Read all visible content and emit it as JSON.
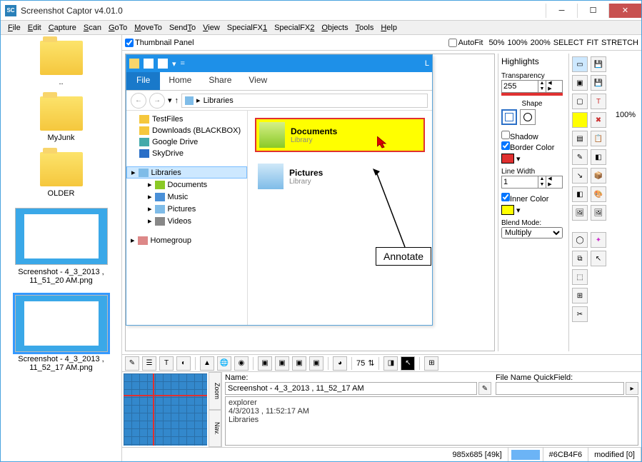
{
  "window": {
    "title": "Screenshot Captor v4.01.0"
  },
  "menus": [
    "File",
    "Edit",
    "Capture",
    "Scan",
    "GoTo",
    "MoveTo",
    "SendTo",
    "View",
    "SpecialFX1",
    "SpecialFX2",
    "Objects",
    "Tools",
    "Help"
  ],
  "left_thumbs": [
    {
      "label": ".."
    },
    {
      "label": "MyJunk"
    },
    {
      "label": "OLDER"
    },
    {
      "label": "Screenshot - 4_3_2013 , 11_51_20 AM.png",
      "type": "ss"
    },
    {
      "label": "Screenshot - 4_3_2013 , 11_52_17 AM.png",
      "type": "ss",
      "selected": true
    }
  ],
  "top_toolbar": {
    "thumbnail_panel": "Thumbnail Panel",
    "autofit": "AutoFit",
    "zoom": [
      "50%",
      "100%",
      "200%",
      "SELECT",
      "FIT",
      "STRETCH"
    ]
  },
  "explorer": {
    "ribbon": {
      "file": "File",
      "tabs": [
        "Home",
        "Share",
        "View"
      ]
    },
    "breadcrumb": "Libraries",
    "tree_top": [
      "TestFiles",
      "Downloads (BLACKBOX)",
      "Google Drive",
      "SkyDrive"
    ],
    "tree_lib": "Libraries",
    "tree_sub": [
      "Documents",
      "Music",
      "Pictures",
      "Videos"
    ],
    "tree_home": "Homegroup",
    "items": [
      {
        "name": "Documents",
        "sub": "Library",
        "hl": true
      },
      {
        "name": "Pictures",
        "sub": "Library"
      }
    ]
  },
  "annotate": "Annotate",
  "highlights": {
    "title": "Highlights",
    "transparency_label": "Transparency",
    "transparency": "255",
    "shape_label": "Shape",
    "shadow_label": "Shadow",
    "border_label": "Border Color",
    "linewidth_label": "Line Width",
    "linewidth": "1",
    "inner_label": "Inner Color",
    "blend_label": "Blend Mode:",
    "blend": "Multiply",
    "border_color": "#e03030",
    "inner_color": "#ffff00"
  },
  "far_right": "100%",
  "bottom_toolbar_num": "75",
  "info": {
    "name_label": "Name:",
    "name": "Screenshot - 4_3_2013 , 11_52_17 AM",
    "quick_label": "File Name QuickField:",
    "quick": "",
    "desc1": "explorer",
    "desc2": "4/3/2013 , 11:52:17 AM",
    "desc3": "Libraries"
  },
  "zoom_tabs": [
    "Zoom",
    "Nav."
  ],
  "status": {
    "dims": "985x685 [49k]",
    "color": "#6CB4F6",
    "modified": "modified [0]"
  }
}
